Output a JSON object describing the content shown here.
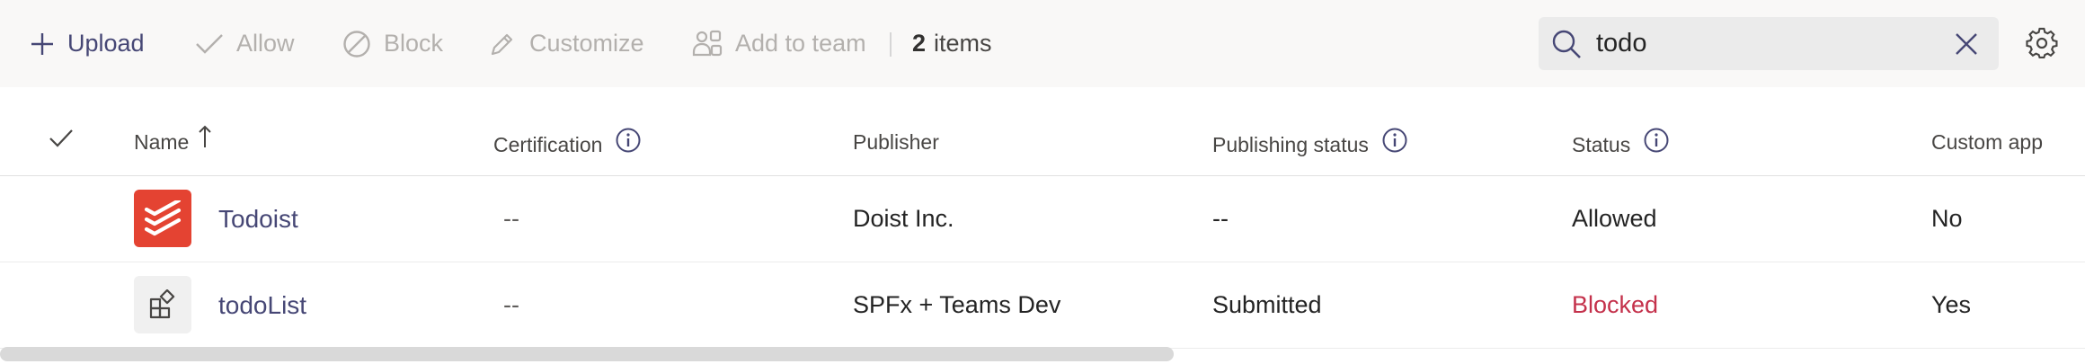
{
  "toolbar": {
    "upload_label": "Upload",
    "allow_label": "Allow",
    "block_label": "Block",
    "customize_label": "Customize",
    "add_to_team_label": "Add to team",
    "items_count": "2",
    "items_suffix": "items"
  },
  "search": {
    "value": "todo",
    "placeholder": "Search"
  },
  "columns": {
    "name": "Name",
    "certification": "Certification",
    "publisher": "Publisher",
    "publishing_status": "Publishing status",
    "status": "Status",
    "custom_app": "Custom app"
  },
  "rows": [
    {
      "name": "Todoist",
      "certification": "--",
      "publisher": "Doist Inc.",
      "publishing_status": "--",
      "status": "Allowed",
      "custom_app": "No",
      "icon": "todoist-logo-icon"
    },
    {
      "name": "todoList",
      "certification": "--",
      "publisher": "SPFx + Teams Dev",
      "publishing_status": "Submitted",
      "status": "Blocked",
      "custom_app": "Yes",
      "icon": "app-grid-icon"
    }
  ],
  "colors": {
    "accent": "#464775",
    "blocked": "#c4314b",
    "todoist_brand": "#e44332",
    "disabled": "#b3b0ad"
  },
  "icons": {
    "upload": "plus-icon",
    "allow": "checkmark-icon",
    "block": "block-circle-icon",
    "customize": "pencil-icon",
    "add_to_team": "people-add-icon",
    "search": "search-icon",
    "clear": "close-icon",
    "settings": "gear-icon",
    "sort": "arrow-up-icon",
    "info": "info-icon"
  }
}
